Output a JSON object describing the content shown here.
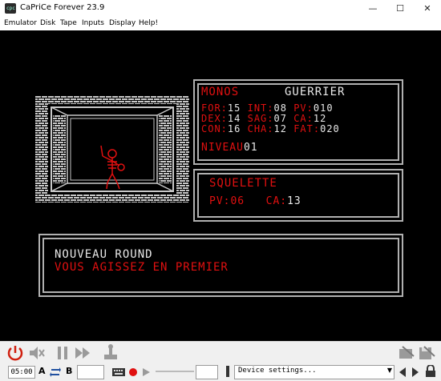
{
  "window": {
    "title": "CaPriCe Forever 23.9",
    "minimize": "—",
    "maximize": "☐",
    "close": "✕"
  },
  "menu": [
    "Emulator",
    "Disk",
    "Tape",
    "Inputs",
    "Display",
    "Help!"
  ],
  "game": {
    "player_name": "MONOS",
    "player_class": "GUERRIER",
    "stats_row1": {
      "for_label": "FOR:",
      "for_val": "15",
      "int_label": "INT:",
      "int_val": "08",
      "pv_label": "PV:",
      "pv_val": "010"
    },
    "stats_row2": {
      "dex_label": "DEX:",
      "dex_val": "14",
      "sag_label": "SAG:",
      "sag_val": "07",
      "ca_label": "CA:",
      "ca_val": "12"
    },
    "stats_row3": {
      "con_label": "CON:",
      "con_val": "16",
      "cha_label": "CHA:",
      "cha_val": "12",
      "fat_label": "FAT:",
      "fat_val": "020"
    },
    "level_label": "NIVEAU",
    "level_val": "01",
    "enemy": {
      "name": "SQUELETTE",
      "pv_label": "PV:",
      "pv_val": "06",
      "ca_label": "CA:",
      "ca_val": "13"
    },
    "message_line1": "NOUVEAU ROUND",
    "message_line2": "VOUS AGISSEZ EN PREMIER"
  },
  "colors": {
    "red": "#e01010",
    "white": "#e8e8e8",
    "frame": "#b0b0b0"
  },
  "toolbar": {
    "time": "05:00",
    "drive_a": "A",
    "drive_b": "B",
    "device_select": "Device settings...",
    "icons": [
      "power-icon",
      "mute-icon",
      "pause-icon",
      "fast-forward-icon",
      "joystick-icon",
      "keyboard-icon",
      "record-icon",
      "play-icon",
      "tape-icon",
      "lock-icon"
    ]
  }
}
